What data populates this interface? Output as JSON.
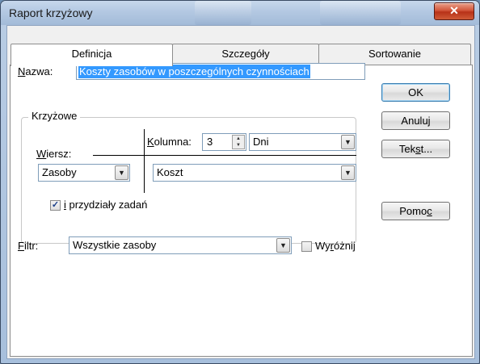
{
  "window": {
    "title": "Raport krzyżowy",
    "close_glyph": "✕"
  },
  "tabs": [
    {
      "label": "Definicja",
      "active": true
    },
    {
      "label": "Szczegóły",
      "active": false
    },
    {
      "label": "Sortowanie",
      "active": false
    }
  ],
  "name_field": {
    "label_accel": "N",
    "label_rest": "azwa:",
    "value": "Koszty zasobów w poszczególnych czynnościach"
  },
  "crosstab": {
    "group_label": "Krzyżowe",
    "column": {
      "label_accel": "K",
      "label_rest": "olumna:",
      "spin_value": "3",
      "unit": "Dni"
    },
    "row": {
      "label_accel": "W",
      "label_rest": "iersz:",
      "value": "Zasoby"
    },
    "field_value": "Koszt",
    "assignments": {
      "checked": true,
      "label_accel": "i",
      "label_rest": " przydziały zadań"
    }
  },
  "filter": {
    "label_accel": "F",
    "label_rest": "iltr:",
    "value": "Wszystkie zasoby"
  },
  "highlight": {
    "checked": false,
    "label_pre": "Wy",
    "label_accel": "r",
    "label_post": "óżnij"
  },
  "buttons": {
    "ok": "OK",
    "cancel": "Anuluj",
    "text_pre": "Tek",
    "text_accel": "s",
    "text_post": "t...",
    "help_pre": "Pomo",
    "help_accel": "c"
  },
  "colors": {
    "selection": "#3399ff",
    "close": "#c9452b"
  }
}
